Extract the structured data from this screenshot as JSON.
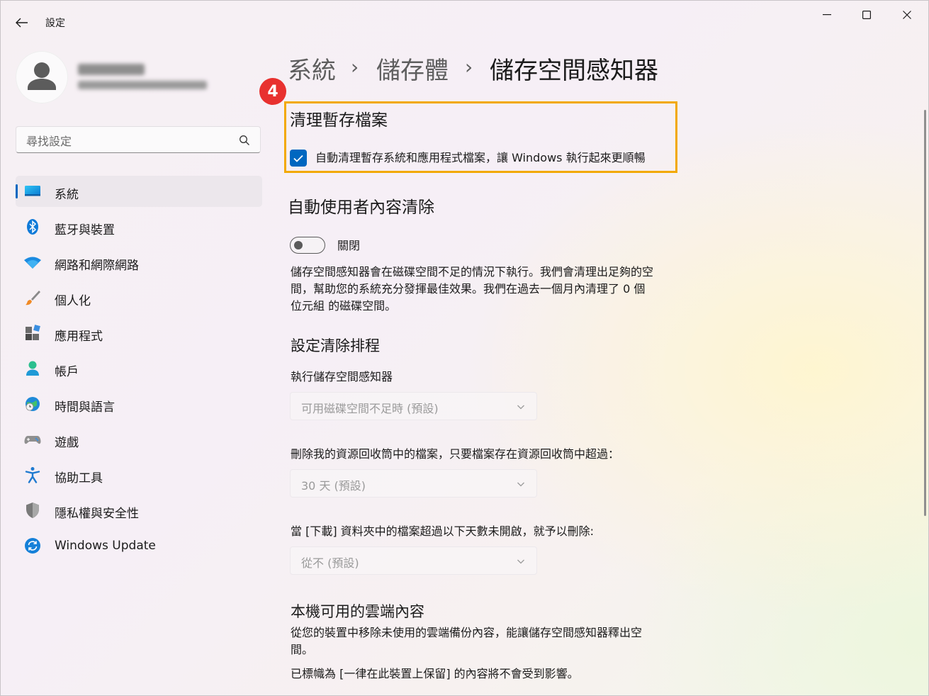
{
  "window": {
    "title": "設定",
    "minimize_icon": "minimize-icon",
    "maximize_icon": "maximize-icon",
    "close_icon": "close-icon"
  },
  "search": {
    "placeholder": "尋找設定"
  },
  "nav": {
    "items": [
      {
        "label": "系統",
        "icon": "system-display-icon",
        "selected": true
      },
      {
        "label": "藍牙與裝置",
        "icon": "bluetooth-icon"
      },
      {
        "label": "網路和網際網路",
        "icon": "wifi-icon"
      },
      {
        "label": "個人化",
        "icon": "paintbrush-icon"
      },
      {
        "label": "應用程式",
        "icon": "apps-icon"
      },
      {
        "label": "帳戶",
        "icon": "account-icon"
      },
      {
        "label": "時間與語言",
        "icon": "globe-clock-icon"
      },
      {
        "label": "遊戲",
        "icon": "gamepad-icon"
      },
      {
        "label": "協助工具",
        "icon": "accessibility-icon"
      },
      {
        "label": "隱私權與安全性",
        "icon": "shield-icon"
      },
      {
        "label": "Windows Update",
        "icon": "windows-update-icon"
      }
    ]
  },
  "breadcrumb": {
    "level1": "系統",
    "level2": "儲存體",
    "current": "儲存空間感知器",
    "separator": "›"
  },
  "annotation": {
    "step": "4"
  },
  "temp_files": {
    "title": "清理暫存檔案",
    "checkbox_label": "自動清理暫存系統和應用程式檔案，讓 Windows 執行起來更順暢",
    "checked": true
  },
  "auto_cleanup": {
    "title": "自動使用者內容清除",
    "toggle_state": "關閉",
    "description_lines": [
      "儲存空間感知器會在磁碟空間不足的情況下執行。我們會清理出足夠的空",
      "間，幫助您的系統充分發揮最佳效果。我們在過去一個月內清理了 0 個",
      "位元組 的磁碟空間。"
    ]
  },
  "schedule": {
    "title": "設定清除排程",
    "run_label": "執行儲存空間感知器",
    "run_value": "可用磁碟空間不足時 (預設)",
    "recycle_label": "刪除我的資源回收筒中的檔案，只要檔案存在資源回收筒中超過：",
    "recycle_value": "30 天 (預設)",
    "downloads_label": "當 [下載] 資料夾中的檔案超過以下天數未開啟，就予以刪除:",
    "downloads_value": "從不 (預設)"
  },
  "cloud": {
    "title": "本機可用的雲端內容",
    "description_lines": [
      "從您的裝置中移除未使用的雲端備份內容，能讓儲存空間感知器釋出空",
      "間。"
    ],
    "note": "已標幟為 [一律在此裝置上保留] 的內容將不會受到影響。"
  },
  "colors": {
    "accent": "#0067c0",
    "highlight": "#f2a900",
    "badge": "#e8312f"
  }
}
